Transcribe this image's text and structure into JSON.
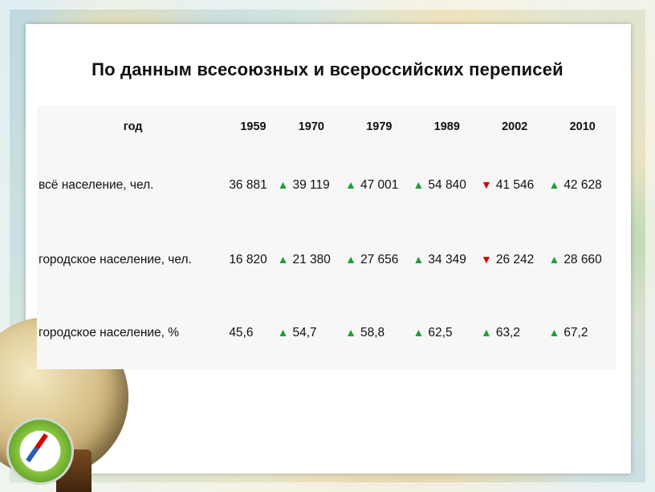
{
  "title": "По данным всесоюзных и всероссийских переписей",
  "table": {
    "header": {
      "label": "год",
      "years": [
        "1959",
        "1970",
        "1979",
        "1989",
        "2002",
        "2010"
      ]
    },
    "rows": [
      {
        "label": "всё население, чел.",
        "cells": [
          {
            "trend": "",
            "value": "36 881"
          },
          {
            "trend": "▲",
            "value": "39 119"
          },
          {
            "trend": "▲",
            "value": "47 001"
          },
          {
            "trend": "▲",
            "value": "54 840"
          },
          {
            "trend": "▼",
            "value": "41 546"
          },
          {
            "trend": "▲",
            "value": "42 628"
          }
        ]
      },
      {
        "label": "городское население, чел.",
        "cells": [
          {
            "trend": "",
            "value": "16 820"
          },
          {
            "trend": "▲",
            "value": "21 380"
          },
          {
            "trend": "▲",
            "value": "27 656"
          },
          {
            "trend": "▲",
            "value": "34 349"
          },
          {
            "trend": "▼",
            "value": "26 242"
          },
          {
            "trend": "▲",
            "value": "28 660"
          }
        ]
      },
      {
        "label": "городское население, %",
        "cells": [
          {
            "trend": "",
            "value": "45,6"
          },
          {
            "trend": "▲",
            "value": "54,7"
          },
          {
            "trend": "▲",
            "value": "58,8"
          },
          {
            "trend": "▲",
            "value": "62,5"
          },
          {
            "trend": "▲",
            "value": "63,2"
          },
          {
            "trend": "▲",
            "value": "67,2"
          }
        ]
      }
    ]
  },
  "colors": {
    "up": "#1f9e3a",
    "down": "#d40000"
  },
  "icons": {
    "decor_globe": "globe-icon",
    "decor_compass": "compass-icon"
  }
}
